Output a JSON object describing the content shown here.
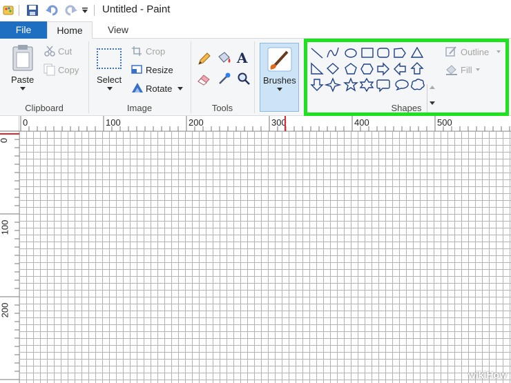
{
  "window": {
    "title": "Untitled - Paint"
  },
  "tabs": [
    {
      "label": "File"
    },
    {
      "label": "Home"
    },
    {
      "label": "View"
    }
  ],
  "ribbon": {
    "clipboard": {
      "paste": "Paste",
      "cut": "Cut",
      "copy": "Copy",
      "group": "Clipboard"
    },
    "image": {
      "select": "Select",
      "crop": "Crop",
      "resize": "Resize",
      "rotate": "Rotate",
      "group": "Image"
    },
    "tools": {
      "group": "Tools"
    },
    "brushes": {
      "label": "Brushes"
    },
    "shapes": {
      "outline": "Outline",
      "fill": "Fill",
      "group": "Shapes"
    }
  },
  "ruler": {
    "top": [
      "0",
      "100",
      "200",
      "300",
      "400",
      "500"
    ],
    "left": [
      "0",
      "100",
      "200"
    ]
  },
  "colors": {
    "accent": "#1e6fc2",
    "highlight": "#1fe21f",
    "marker": "#e0262a"
  },
  "watermark": "wikiHow"
}
